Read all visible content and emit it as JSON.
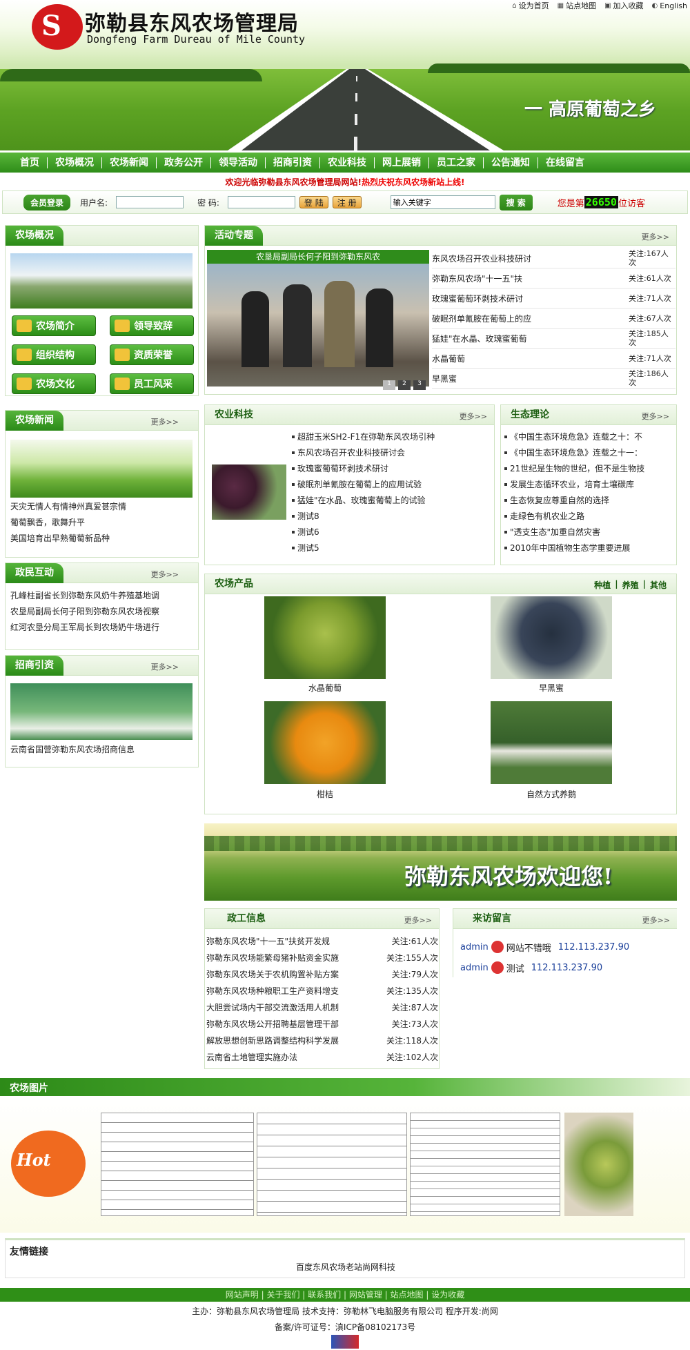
{
  "header": {
    "title": "弥勒县东风农场管理局",
    "subtitle": "Dongfeng Farm Dureau of Mile County",
    "slogan": "一 高原葡萄之乡",
    "toplinks": [
      {
        "label": "设为首页",
        "icon": "home-icon"
      },
      {
        "label": "站点地图",
        "icon": "sitemap-icon"
      },
      {
        "label": "加入收藏",
        "icon": "favorite-icon"
      },
      {
        "label": "English",
        "icon": "globe-icon"
      }
    ]
  },
  "nav": [
    "首页",
    "农场概况",
    "农场新闻",
    "政务公开",
    "领导活动",
    "招商引资",
    "农业科技",
    "网上展销",
    "员工之家",
    "公告通知",
    "在线留言"
  ],
  "welcome": {
    "text": "欢迎光临弥勒县东风农场管理局网站!",
    "highlight": "热烈庆祝东风农场新站上线!"
  },
  "login": {
    "tag": "会员登录",
    "username_label": "用户名:",
    "password_label": "密 码:",
    "login_btn": "登 陆",
    "register_btn": "注 册",
    "search_placeholder": "输入关键字",
    "search_btn": "搜 索",
    "visitor_prefix": "您是第",
    "visitor_count": "26650",
    "visitor_suffix": "位访客"
  },
  "sidebar": {
    "overview": {
      "title": "农场概况",
      "buttons": [
        "农场简介",
        "领导致辞",
        "组织结构",
        "资质荣誉",
        "农场文化",
        "员工风采"
      ]
    },
    "news": {
      "title": "农场新闻",
      "more": "更多>>",
      "items": [
        "天灾无情人有情神州真爱甚宗情",
        "葡萄飘香，歌舞升平",
        "美国培育出早熟葡萄新品种"
      ]
    },
    "interaction": {
      "title": "政民互动",
      "more": "更多>>",
      "items": [
        "孔峰柱副省长到弥勒东风奶牛养殖基地调",
        "农垦局副局长何子阳到弥勒东风农场视察",
        "红河农垦分局王军局长到农场奶牛场进行"
      ]
    },
    "investment": {
      "title": "招商引资",
      "more": "更多>>",
      "items": [
        "云南省国营弥勒东风农场招商信息"
      ]
    }
  },
  "activity": {
    "title": "活动专题",
    "more": "更多>>",
    "slide_caption": "农垦局副局长何子阳到弥勒东风农",
    "slide_pages": [
      "1",
      "2",
      "3"
    ],
    "items": [
      {
        "title": "东风农场召开农业科技研讨",
        "views": "关注:167人次"
      },
      {
        "title": "弥勒东风农场\"十一五\"扶",
        "views": "关注:61人次"
      },
      {
        "title": "玫瑰蜜葡萄环剥技术研讨",
        "views": "关注:71人次"
      },
      {
        "title": "破眠剂单氰胺在葡萄上的应",
        "views": "关注:67人次"
      },
      {
        "title": "猛娃\"在水晶、玫瑰蜜葡萄",
        "views": "关注:185人次"
      },
      {
        "title": "水晶葡萄",
        "views": "关注:71人次"
      },
      {
        "title": "早黑蜜",
        "views": "关注:186人次"
      }
    ]
  },
  "agri_tech": {
    "title": "农业科技",
    "more": "更多>>",
    "items": [
      "超甜玉米SH2-F1在弥勒东风农场引种",
      "东风农场召开农业科技研讨会",
      "玫瑰蜜葡萄环剥技术研讨",
      "破眠剂单氰胺在葡萄上的应用试验",
      "猛娃\"在水晶、玫瑰蜜葡萄上的试验",
      "测试8",
      "测试6",
      "测试5"
    ]
  },
  "ecology": {
    "title": "生态理论",
    "more": "更多>>",
    "items": [
      "《中国生态环境危急》连载之十：不",
      "《中国生态环境危急》连载之十一：",
      "21世纪是生物的世纪，但不是生物技",
      "发展生态循环农业，培育土壤碳库",
      "生态恢复应尊重自然的选择",
      "走绿色有机农业之路",
      "\"透支生态\"加重自然灾害",
      "2010年中国植物生态学重要进展"
    ]
  },
  "products": {
    "title": "农场产品",
    "tabs": [
      "种植",
      "养殖",
      "其他"
    ],
    "items": [
      "水晶葡萄",
      "早黑蜜",
      "柑桔",
      "自然方式养鹅"
    ]
  },
  "banner": {
    "text": "弥勒东风农场欢迎您!"
  },
  "gov_info": {
    "title": "政工信息",
    "more": "更多>>",
    "items": [
      {
        "title": "弥勒东风农场\"十一五\"扶贫开发规",
        "views": "关注:61人次"
      },
      {
        "title": "弥勒东风农场能繁母猪补贴资金实施",
        "views": "关注:155人次"
      },
      {
        "title": "弥勒东风农场关于农机购置补贴方案",
        "views": "关注:79人次"
      },
      {
        "title": "弥勒东风农场种粮职工生产资料增支",
        "views": "关注:135人次"
      },
      {
        "title": "大胆尝试场内干部交流激活用人机制",
        "views": "关注:87人次"
      },
      {
        "title": "弥勒东风农场公开招聘基层管理干部",
        "views": "关注:73人次"
      },
      {
        "title": "解放思想创新思路调整结构科学发展",
        "views": "关注:118人次"
      },
      {
        "title": "云南省土地管理实施办法",
        "views": "关注:102人次"
      }
    ]
  },
  "guestbook": {
    "title": "来访留言",
    "more": "更多>>",
    "items": [
      {
        "user": "admin",
        "text": "网站不错哦",
        "ip": "112.113.237.90"
      },
      {
        "user": "admin",
        "text": "测试",
        "ip": "112.113.237.90"
      }
    ]
  },
  "photos": {
    "title": "农场图片",
    "hot": "Hot"
  },
  "links": {
    "title": "友情链接",
    "items": [
      "百度",
      "东风农场老站",
      "尚网科技"
    ]
  },
  "footer": {
    "links": [
      "网站声明",
      "关于我们",
      "联系我们",
      "网站管理",
      "站点地图",
      "设为收藏"
    ],
    "line1": "主办：弥勒县东风农场管理局 技术支持：弥勒林飞电脑服务有限公司 程序开发:尚网",
    "line2": "备案/许可证号：滇ICP备08102173号"
  }
}
